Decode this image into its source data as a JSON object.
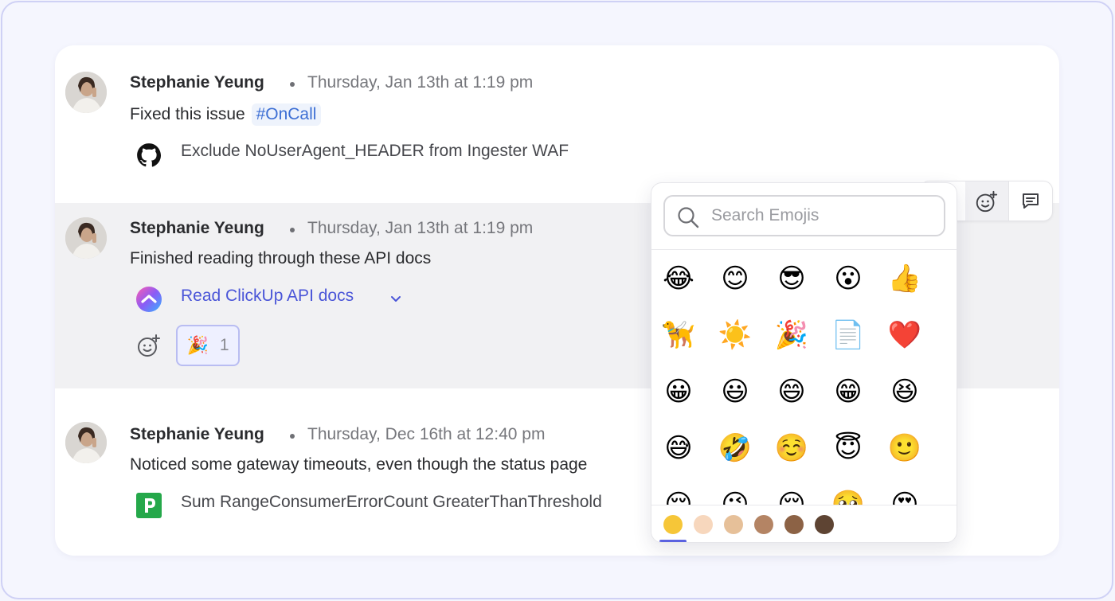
{
  "messages": [
    {
      "author": "Stephanie Yeung",
      "timestamp": "Thursday, Jan 13th at 1:19 pm",
      "text": "Fixed this issue",
      "tag": "#OnCall",
      "attachment": {
        "icon": "github-icon",
        "text": "Exclude NoUserAgent_HEADER from Ingester WAF"
      }
    },
    {
      "author": "Stephanie Yeung",
      "timestamp": "Thursday, Jan 13th at 1:19 pm",
      "text": "Finished reading through these API docs",
      "attachment": {
        "icon": "clickup-icon",
        "text": "Read ClickUp API docs"
      },
      "reaction": {
        "emoji": "🎉",
        "count": "1"
      }
    },
    {
      "author": "Stephanie Yeung",
      "timestamp": "Thursday, Dec 16th at 12:40 pm",
      "text": "Noticed some gateway timeouts, even though the status page",
      "attachment": {
        "icon": "pagerduty-icon",
        "text": "Sum RangeConsumerErrorCount GreaterThanThreshold"
      }
    }
  ],
  "emoji_picker": {
    "search_placeholder": "Search Emojis",
    "emojis": [
      "😂",
      "😊",
      "😎",
      "😮",
      "👍",
      "🦮",
      "☀️",
      "🎉",
      "📄",
      "❤️",
      "😀",
      "😃",
      "😄",
      "😁",
      "😆",
      "😅",
      "🤣",
      "☺️",
      "😇",
      "🙂",
      "😌",
      "😉",
      "😌",
      "🥺",
      "😍"
    ],
    "skin_tones": [
      "#f6c638",
      "#f7d7bd",
      "#e6c099",
      "#b48464",
      "#8c6245",
      "#5e4433"
    ]
  },
  "colors": {
    "accent": "#5b62e0",
    "link": "#4a55d8",
    "tag": "#3d6fd4"
  }
}
